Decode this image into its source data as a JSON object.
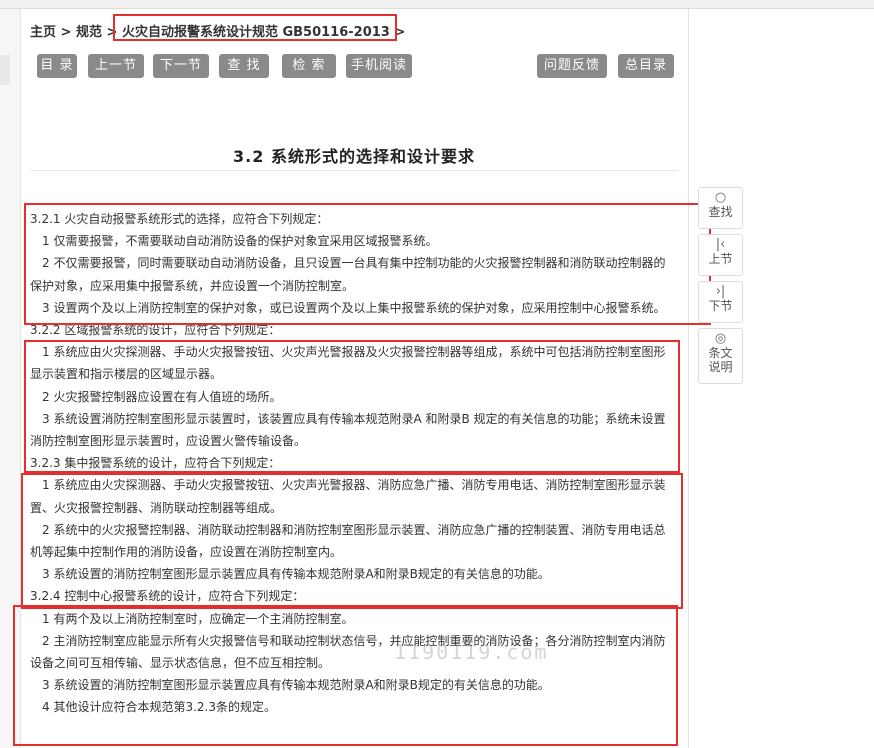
{
  "breadcrumb": {
    "home": "主页",
    "sep1": " > ",
    "category": "规范",
    "sep2": " > ",
    "current": "火灾自动报警系统设计规范 GB50116-2013",
    "sep3": " >"
  },
  "toolbar": {
    "contents": "目 录",
    "prev": "上一节",
    "next": "下一节",
    "find": "查 找",
    "search": "检 索",
    "mobile": "手机阅读",
    "feedback": "问题反馈",
    "index": "总目录"
  },
  "section_title": "3.2  系统形式的选择和设计要求",
  "side_tools": {
    "find": "查找",
    "prev": "上节",
    "next": "下节",
    "notes_line1": "条文",
    "notes_line2": "说明"
  },
  "content": {
    "s1": {
      "head": "3.2.1 火灾自动报警系统形式的选择，应符合下列规定：",
      "items": [
        "1 仅需要报警，不需要联动自动消防设备的保护对象宜采用区域报警系统。",
        "2 不仅需要报警，同时需要联动自动消防设备，且只设置一台具有集中控制功能的火灾报警控制器和消防联动控制器的保护对象，应采用集中报警系统，并应设置一个消防控制室。",
        "3 设置两个及以上消防控制室的保护对象，或已设置两个及以上集中报警系统的保护对象，应采用控制中心报警系统。"
      ]
    },
    "s2": {
      "head": "3.2.2 区域报警系统的设计，应符合下列规定：",
      "items": [
        "1 系统应由火灾探测器、手动火灾报警按钮、火灾声光警报器及火灾报警控制器等组成，系统中可包括消防控制室图形显示装置和指示楼层的区域显示器。",
        "2 火灾报警控制器应设置在有人值班的场所。",
        "3 系统设置消防控制室图形显示装置时，该装置应具有传输本规范附录A 和附录B 规定的有关信息的功能；系统未设置消防控制室图形显示装置时，应设置火警传输设备。"
      ]
    },
    "s3": {
      "head": "3.2.3 集中报警系统的设计，应符合下列规定：",
      "items": [
        "1 系统应由火灾探测器、手动火灾报警按钮、火灾声光警报器、消防应急广播、消防专用电话、消防控制室图形显示装置、火灾报警控制器、消防联动控制器等组成。",
        "2 系统中的火灾报警控制器、消防联动控制器和消防控制室图形显示装置、消防应急广播的控制装置、消防专用电话总机等起集中控制作用的消防设备，应设置在消防控制室内。",
        "3 系统设置的消防控制室图形显示装置应具有传输本规范附录A和附录B规定的有关信息的功能。"
      ]
    },
    "s4": {
      "head": "3.2.4 控制中心报警系统的设计，应符合下列规定：",
      "items": [
        "1 有两个及以上消防控制室时，应确定一个主消防控制室。",
        "2 主消防控制室应能显示所有火灾报警信号和联动控制状态信号，并应能控制重要的消防设备；各分消防控制室内消防设备之间可互相传输、显示状态信息，但不应互相控制。",
        "3 系统设置的消防控制室图形显示装置应具有传输本规范附录A和附录B规定的有关信息的功能。",
        "4 其他设计应符合本规范第3.2.3条的规定。"
      ]
    }
  },
  "watermark": "1190119.com",
  "colors": {
    "button_bg": "#8a8a8a",
    "highlight_border": "#e3302e"
  }
}
